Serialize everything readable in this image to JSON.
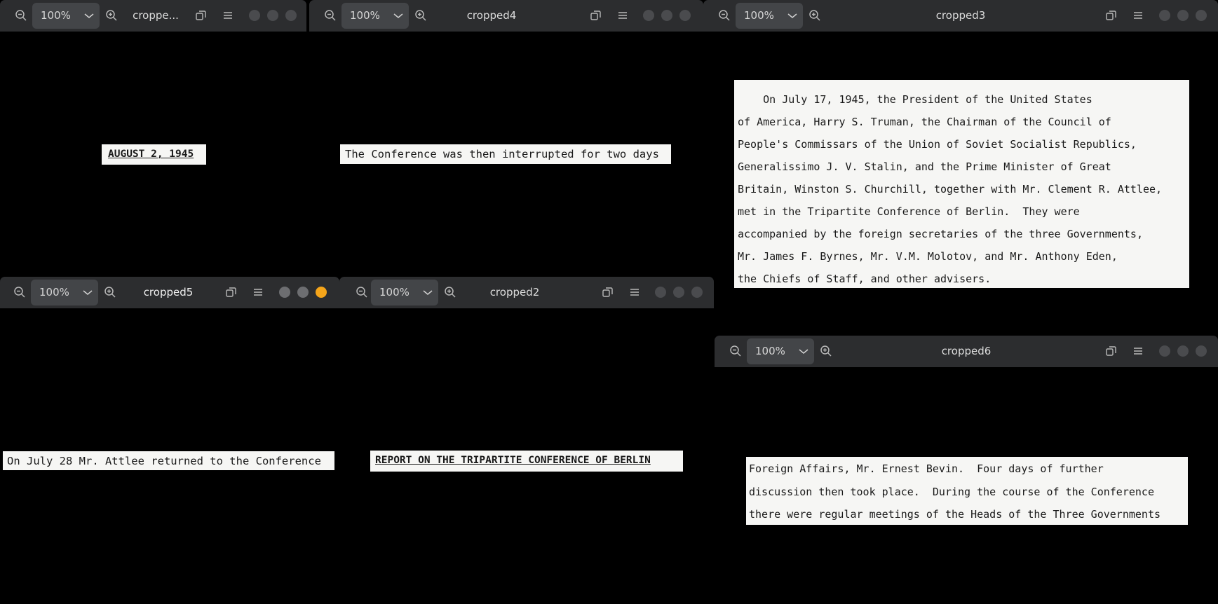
{
  "zoom": {
    "value": "100%"
  },
  "windows": {
    "w1": {
      "title": "croppe...",
      "doc": {
        "lines": [
          "AUGUST 2, 1945"
        ]
      }
    },
    "w4": {
      "title": "cropped4",
      "doc": {
        "lines": [
          "The Conference was then interrupted for two days"
        ]
      }
    },
    "w3": {
      "title": "cropped3",
      "doc": {
        "lines": [
          "    On July 17, 1945, the President of the United States",
          "of America, Harry S. Truman, the Chairman of the Council of",
          "People's Commissars of the Union of Soviet Socialist Republics,",
          "Generalissimo J. V. Stalin, and the Prime Minister of Great",
          "Britain, Winston S. Churchill, together with Mr. Clement R. Attlee,",
          "met in the Tripartite Conference of Berlin.  They were",
          "accompanied by the foreign secretaries of the three Governments,",
          "Mr. James F. Byrnes, Mr. V.M. Molotov, and Mr. Anthony Eden,",
          "the Chiefs of Staff, and other advisers."
        ]
      }
    },
    "w5": {
      "title": "cropped5",
      "doc": {
        "lines": [
          "On July 28 Mr. Attlee returned to the Conference"
        ]
      }
    },
    "w2": {
      "title": "cropped2",
      "doc": {
        "lines": [
          "REPORT ON THE TRIPARTITE CONFERENCE OF BERLIN"
        ]
      }
    },
    "w6": {
      "title": "cropped6",
      "doc": {
        "lines": [
          "Foreign Affairs, Mr. Ernest Bevin.  Four days of further",
          "discussion then took place.  During the course of the Conference",
          "there were regular meetings of the Heads of the Three Governments"
        ]
      }
    }
  },
  "colors": {
    "titlebar": "#2c2d2f",
    "zoom_box": "#434548",
    "active_dot": "#f5a51a",
    "background": "#000000"
  },
  "icons": [
    "zoom-out-icon",
    "zoom-in-icon",
    "chevron-down-icon",
    "restore-icon",
    "menu-icon"
  ]
}
